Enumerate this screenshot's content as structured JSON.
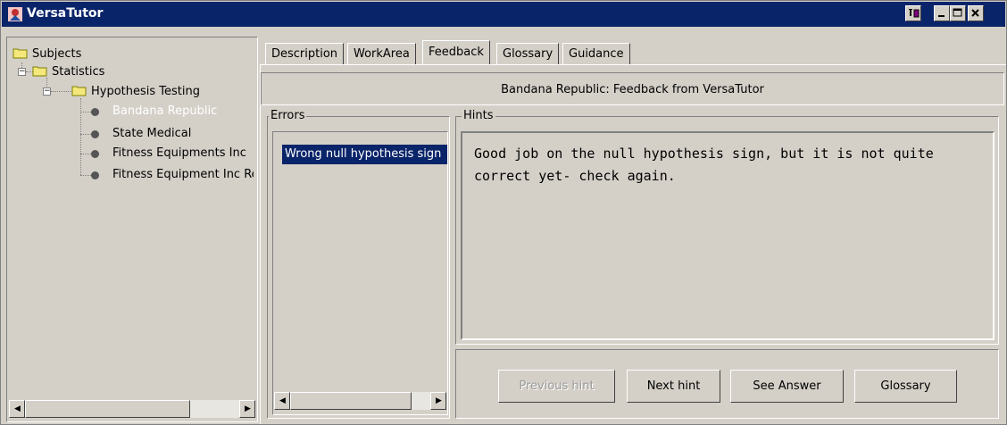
{
  "window": {
    "title": "VersaTutor"
  },
  "tree": {
    "root": "Subjects",
    "subject": "Statistics",
    "topic": "Hypothesis Testing",
    "problems": [
      "Bandana Republic",
      "State Medical",
      "Fitness Equipments Inc",
      "Fitness Equipment Inc Re"
    ]
  },
  "tabs": [
    "Description",
    "WorkArea",
    "Feedback",
    "Glossary",
    "Guidance"
  ],
  "header": {
    "title": "Bandana Republic: Feedback from VersaTutor"
  },
  "errors": {
    "label": "Errors",
    "items": [
      "Wrong null hypothesis sign"
    ]
  },
  "hints": {
    "label": "Hints",
    "text": "Good job on the null hypothesis sign, but it is not quite correct yet- check again."
  },
  "buttons": {
    "previous": "Previous hint",
    "next": "Next hint",
    "answer": "See Answer",
    "glossary": "Glossary"
  },
  "colors": {
    "titlebar": "#0a246a",
    "selection": "#0a246a",
    "panel": "#d4d0c8"
  }
}
